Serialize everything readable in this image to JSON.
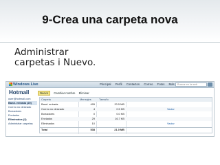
{
  "slide": {
    "title": "9-Crea una carpeta nova",
    "bullet": "Administrar carpetas i Nuevo."
  },
  "screenshot": {
    "logo": "Windows Live",
    "top_nav": [
      "Principal",
      "Perfil",
      "Contactos",
      "Correo",
      "Fotos",
      "Más",
      "MSN"
    ],
    "search_placeholder": "Buscar en la web",
    "app_title": "Hotmail",
    "toolbar": [
      "Nuevo",
      "Cambiar nombre",
      "Eliminar"
    ],
    "sidebar": {
      "account": "user@hotmail.com",
      "inbox": "Band. entrada (20)",
      "items": [
        "Correo no deseado",
        "Borradores",
        "Enviados"
      ],
      "deleted": "Eliminados (2)",
      "manage": "Administrar carpetas"
    },
    "table": {
      "columns": [
        "Carpeta",
        "Mensajes",
        "Tamaño",
        ""
      ],
      "rows": [
        {
          "folder": "Band. entrada",
          "messages": "495",
          "size": "20.5 MB",
          "action": ""
        },
        {
          "folder": "Correo no deseado",
          "messages": "4",
          "size": "0.5 KB",
          "action": "Vaciar"
        },
        {
          "folder": "Borradores",
          "messages": "0",
          "size": "0.0 KB",
          "action": ""
        },
        {
          "folder": "Enviados",
          "messages": "29",
          "size": "16.7 KB",
          "action": ""
        },
        {
          "folder": "Eliminados",
          "messages": "10",
          "size": "",
          "action": "Vaciar"
        }
      ],
      "total": {
        "folder": "Total",
        "messages": "538",
        "size": "21.0 MB"
      }
    }
  }
}
